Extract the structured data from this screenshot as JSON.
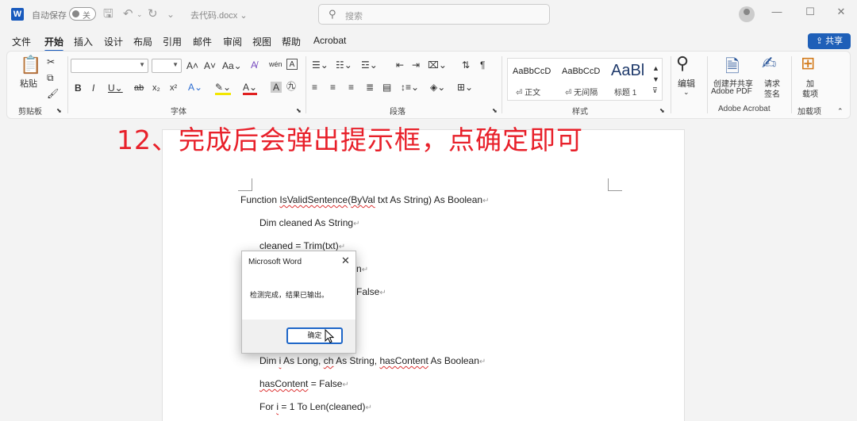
{
  "titlebar": {
    "autosave_label": "自动保存",
    "autosave_state": "关",
    "doc_title": "去代码.docx ⌄",
    "search_placeholder": "搜索",
    "word_logo": "W"
  },
  "tabs": [
    "文件",
    "开始",
    "插入",
    "设计",
    "布局",
    "引用",
    "邮件",
    "审阅",
    "视图",
    "帮助",
    "Acrobat"
  ],
  "active_tab": "开始",
  "share_label": "共享",
  "ribbon": {
    "paste_label": "粘贴",
    "clipboard_group": "剪贴板",
    "font_group": "字体",
    "paragraph_group": "段落",
    "styles_group": "样式",
    "styles": [
      {
        "sample": "AaBbCcD",
        "name": "⏎ 正文"
      },
      {
        "sample": "AaBbCcD",
        "name": "⏎ 无间隔"
      },
      {
        "sample": "AaBl",
        "name": "标题 1"
      }
    ],
    "edit_label": "编辑",
    "create_pdf_label_1": "创建并共享",
    "create_pdf_label_2": "Adobe PDF",
    "sign_label_1": "请求",
    "sign_label_2": "签名",
    "addin_label_1": "加",
    "addin_label_2": "载项",
    "acrobat_group": "Adobe Acrobat",
    "addins_group": "加载项"
  },
  "annotation": "12、完成后会弹出提示框，点确定即可",
  "code_lines": {
    "l1_a": "Function ",
    "l1_b": "IsValidSentence",
    "l1_c": "(",
    "l1_d": "ByVal",
    "l1_e": " txt As String) As Boolean",
    "l2": "Dim cleaned As String",
    "l3": "cleaned = Trim(txt)",
    "l4_tail": "n",
    "l5_tail": "False",
    "l8_a": "Dim ",
    "l8_b": "i",
    "l8_c": " As Long, ",
    "l8_d": "ch",
    "l8_e": " As String, ",
    "l8_f": "hasContent",
    "l8_g": " As Boolean",
    "l9_a": "hasContent",
    "l9_b": " = False",
    "l10_a": "For ",
    "l10_b": "i",
    "l10_c": " = 1 To Len(cleaned)"
  },
  "para_mark": "↵",
  "dialog": {
    "title": "Microsoft Word",
    "message": "检测完成，结果已输出。",
    "ok_label": "确定"
  }
}
